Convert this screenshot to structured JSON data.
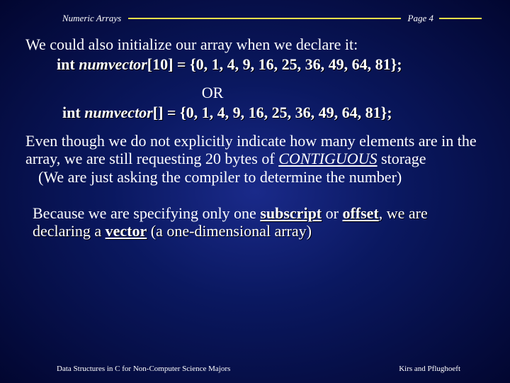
{
  "header": {
    "title": "Numeric Arrays",
    "page": "Page 4"
  },
  "line1": "We could also initialize our array when we declare it:",
  "code1": {
    "kw": "int ",
    "name": "numvector",
    "rest": "[10] = {0, 1, 4, 9, 16, 25, 36, 49, 64, 81};"
  },
  "or": "OR",
  "code2": {
    "kw": "int ",
    "name": "numvector",
    "rest": "[] = {0, 1, 4, 9, 16, 25, 36, 49, 64, 81};"
  },
  "para2": {
    "a": "Even though we do not explicitly indicate how many elements are in the array, we are still requesting 20 bytes of ",
    "contig": "CONTIGUOUS",
    "b": " storage",
    "c": "(We are just asking the compiler to determine the number)"
  },
  "para3": {
    "a": "Because we are specifying only one ",
    "sub": "subscript",
    "b": " or ",
    "off": "offset",
    "c": ", we are declaring a ",
    "vec": "vector",
    "d": " (a one-dimensional array)"
  },
  "footer": {
    "left": "Data Structures in C for Non-Computer Science Majors",
    "right": "Kirs and Pflughoeft"
  }
}
